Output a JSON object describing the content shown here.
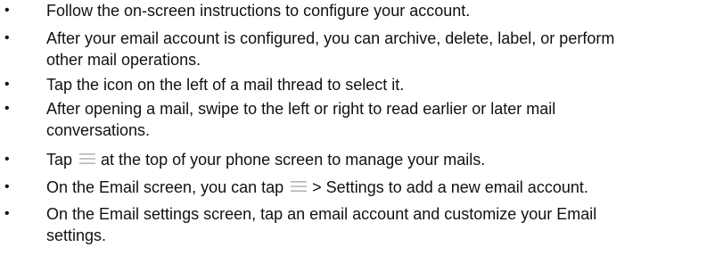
{
  "bullets": [
    {
      "lines": [
        "Follow the on-screen instructions to configure your account."
      ]
    },
    {
      "lines": [
        "After your email account is configured, you can archive, delete, label, or perform",
        "other mail operations."
      ]
    },
    {
      "lines": [
        "Tap the icon on the left of a mail thread to select it."
      ]
    },
    {
      "lines": [
        "After opening a mail, swipe to the left or right to read earlier or later mail",
        "conversations."
      ]
    },
    {
      "before": "Tap",
      "icon": "menu-icon",
      "after": "at the top of your phone screen to manage your mails."
    },
    {
      "before": "On the Email screen, you can tap",
      "icon": "menu-icon",
      "after": "> Settings to add a new email account."
    },
    {
      "lines": [
        "On the Email settings screen, tap an email account and customize your Email",
        "settings."
      ]
    }
  ],
  "bullet_glyph": "•",
  "colors": {
    "text": "#111111",
    "icon": "#b5b5b5"
  }
}
